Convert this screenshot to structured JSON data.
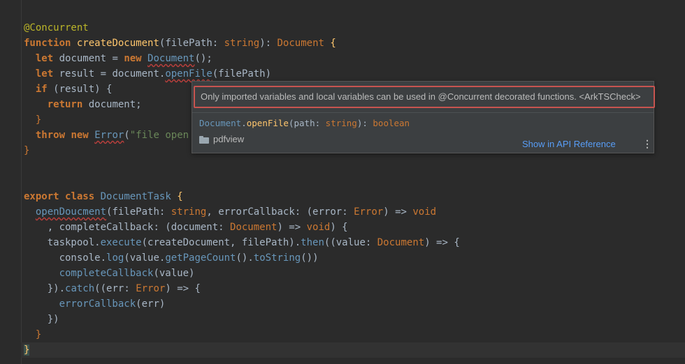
{
  "code_lines": [
    "@Concurrent",
    "function createDocument(filePath: string): Document {",
    "  let document = new Document();",
    "  let result = document.openFile(filePath)",
    "  if (result) {",
    "    return document;",
    "  }",
    "  throw new Error(\"file open f",
    "}",
    "",
    "",
    "export class DocumentTask {",
    "  openDoucment(filePath: string, errorCallback: (error: Error) => void",
    "    , completeCallback: (document: Document) => void) {",
    "    taskpool.execute(createDocument, filePath).then((value: Document) => {",
    "      console.log(value.getPageCount().toString())",
    "      completeCallback(value)",
    "    }).catch((err: Error) => {",
    "      errorCallback(err)",
    "    })",
    "  }",
    "}"
  ],
  "popup": {
    "message": "Only imported variables and local variables can be used in @Concurrent decorated functions. <ArkTSCheck>",
    "signature": {
      "class": "Document",
      "method": "openFile",
      "param": "path",
      "param_type": "string",
      "return_type": "boolean"
    },
    "module": "pdfview",
    "link": "Show in API Reference",
    "more": "⋮"
  }
}
